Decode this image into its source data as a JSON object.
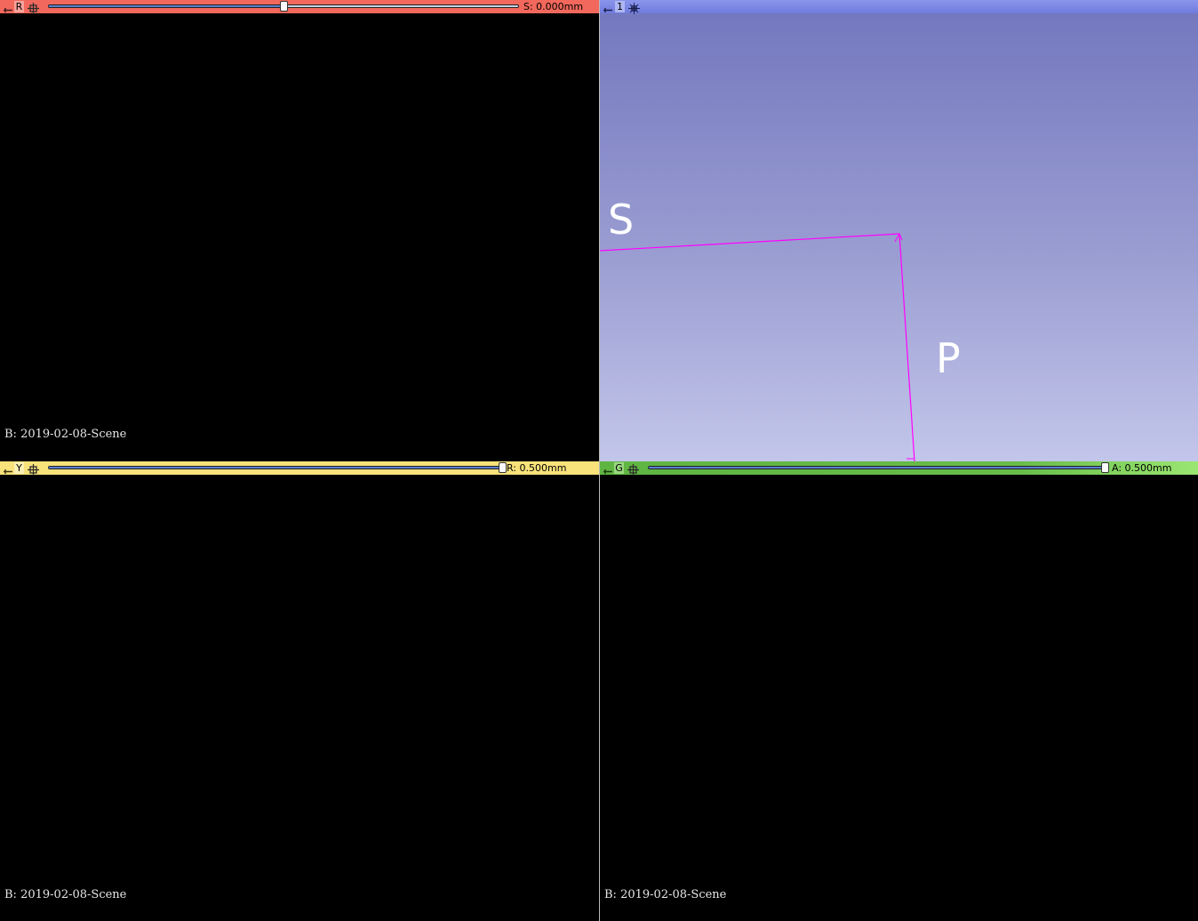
{
  "views": {
    "red": {
      "letter": "R",
      "offset": "S: 0.000mm",
      "slider_fraction": 0.5,
      "scene_label": "B: 2019-02-08-Scene",
      "bar_color": "#f2685c"
    },
    "three_d": {
      "letter": "1",
      "bar_color": "#7b86e3",
      "axis_labels": {
        "superior": "S",
        "posterior": "P"
      },
      "axis_line_color": "#ff00ff"
    },
    "yellow": {
      "letter": "Y",
      "offset": "R: 0.500mm",
      "slider_fraction": 1.0,
      "scene_label": "B: 2019-02-08-Scene",
      "bar_color": "#f8e27a"
    },
    "green": {
      "letter": "G",
      "offset": "A: 0.500mm",
      "slider_fraction": 1.0,
      "scene_label": "B: 2019-02-08-Scene",
      "bar_color": "#7fd061"
    }
  },
  "icons": {
    "pin": "pin-icon",
    "slice_controls": "slice-controls-icon",
    "view_controls": "view-controls-icon"
  }
}
